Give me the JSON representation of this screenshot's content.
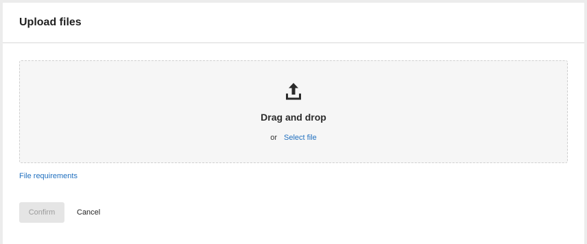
{
  "dialog": {
    "title": "Upload files"
  },
  "dropzone": {
    "icon": "upload-icon",
    "heading": "Drag and drop",
    "or_text": "or",
    "select_file_label": "Select file"
  },
  "links": {
    "file_requirements": "File requirements"
  },
  "actions": {
    "confirm_label": "Confirm",
    "confirm_disabled": true,
    "cancel_label": "Cancel"
  },
  "colors": {
    "link": "#1f6fbf",
    "dropzone_bg": "#f6f6f6",
    "dropzone_border": "#cfcfcf",
    "disabled_bg": "#e5e5e5",
    "disabled_text": "#9b9b9b"
  }
}
